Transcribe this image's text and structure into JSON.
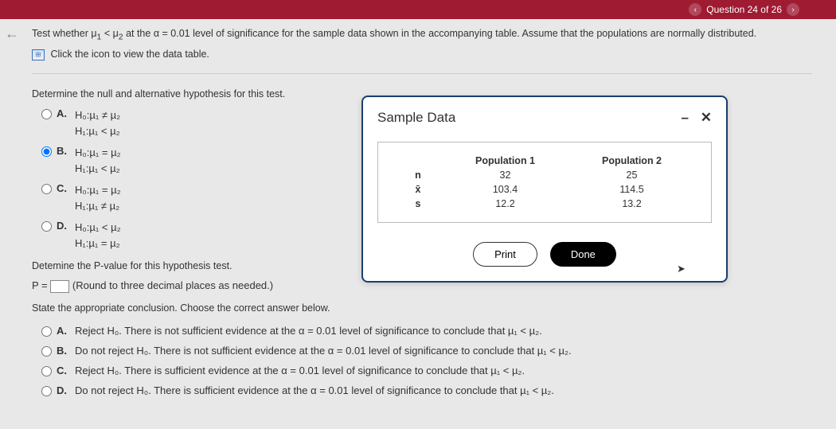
{
  "header": {
    "question_label": "Question 24 of 26"
  },
  "prompt": {
    "line1_pre": "Test whether μ",
    "line1_s1": "1",
    "line1_mid": " < μ",
    "line1_s2": "2",
    "line1_post": " at the α = 0.01 level of significance for the sample data shown in the accompanying table. Assume that the populations are normally distributed.",
    "line2": "Click the icon to view the data table."
  },
  "q1": {
    "title": "Determine the null and alternative hypothesis for this test.",
    "options": {
      "A": {
        "label": "A.",
        "h0": "H₀:µ₁ ≠ µ₂",
        "h1": "H₁:µ₁ < µ₂"
      },
      "B": {
        "label": "B.",
        "h0": "H₀:µ₁ = µ₂",
        "h1": "H₁:µ₁ < µ₂"
      },
      "C": {
        "label": "C.",
        "h0": "H₀:µ₁ = µ₂",
        "h1": "H₁:µ₁ ≠ µ₂"
      },
      "D": {
        "label": "D.",
        "h0": "H₀:µ₁ < µ₂",
        "h1": "H₁:µ₁ = µ₂"
      }
    }
  },
  "q2": {
    "title": "Detemine the P-value for this hypothesis test.",
    "prefix": "P = ",
    "suffix": " (Round to three decimal places as needed.)"
  },
  "q3": {
    "title": "State the appropriate conclusion. Choose the correct answer below.",
    "options": {
      "A": {
        "label": "A.",
        "text": "Reject H₀. There is not sufficient evidence at the α = 0.01 level of significance to conclude that µ₁ < µ₂."
      },
      "B": {
        "label": "B.",
        "text": "Do not reject H₀. There is not sufficient evidence at the α = 0.01 level of significance to conclude that µ₁ < µ₂."
      },
      "C": {
        "label": "C.",
        "text": "Reject H₀. There is sufficient evidence at the α = 0.01 level of significance to conclude that µ₁ < µ₂."
      },
      "D": {
        "label": "D.",
        "text": "Do not reject H₀. There is sufficient evidence at the α = 0.01 level of significance to conclude that µ₁ < µ₂."
      }
    }
  },
  "modal": {
    "title": "Sample Data",
    "minimize": "–",
    "close": "✕",
    "headers": {
      "empty": "",
      "p1": "Population 1",
      "p2": "Population 2"
    },
    "rows": {
      "n": {
        "label": "n",
        "p1": "32",
        "p2": "25"
      },
      "xbar": {
        "label": "x̄",
        "p1": "103.4",
        "p2": "114.5"
      },
      "s": {
        "label": "s",
        "p1": "12.2",
        "p2": "13.2"
      }
    },
    "print": "Print",
    "done": "Done"
  }
}
